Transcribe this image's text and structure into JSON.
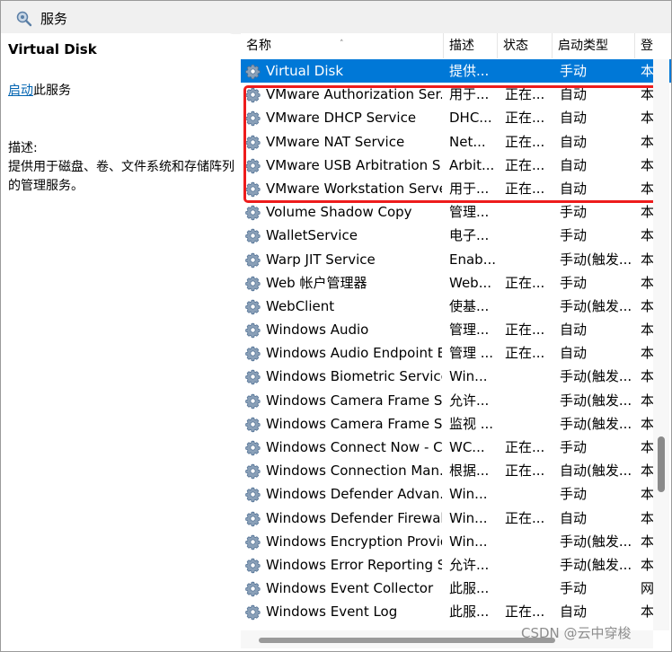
{
  "window": {
    "title": "服务"
  },
  "left_pane": {
    "service_title": "Virtual Disk",
    "start_link": "启动",
    "start_suffix": "此服务",
    "description_label": "描述:",
    "description_text": "提供用于磁盘、卷、文件系统和存储阵列的管理服务。"
  },
  "columns": {
    "name": "名称",
    "description": "描述",
    "status": "状态",
    "startup_type": "启动类型",
    "logon_as": "登"
  },
  "services": [
    {
      "name": "Virtual Disk",
      "description": "提供...",
      "status": "",
      "startup": "手动",
      "logon": "本",
      "selected": true
    },
    {
      "name": "VMware Authorization Ser...",
      "description": "用于...",
      "status": "正在...",
      "startup": "自动",
      "logon": "本"
    },
    {
      "name": "VMware DHCP Service",
      "description": "DHC...",
      "status": "正在...",
      "startup": "自动",
      "logon": "本"
    },
    {
      "name": "VMware NAT Service",
      "description": "Net...",
      "status": "正在...",
      "startup": "自动",
      "logon": "本"
    },
    {
      "name": "VMware USB Arbitration S...",
      "description": "Arbit...",
      "status": "正在...",
      "startup": "自动",
      "logon": "本"
    },
    {
      "name": "VMware Workstation Server",
      "description": "用于...",
      "status": "正在...",
      "startup": "自动",
      "logon": "本"
    },
    {
      "name": "Volume Shadow Copy",
      "description": "管理...",
      "status": "",
      "startup": "手动",
      "logon": "本"
    },
    {
      "name": "WalletService",
      "description": "电子...",
      "status": "",
      "startup": "手动",
      "logon": "本"
    },
    {
      "name": "Warp JIT Service",
      "description": "Enab...",
      "status": "",
      "startup": "手动(触发...",
      "logon": "本"
    },
    {
      "name": "Web 帐户管理器",
      "description": "Web...",
      "status": "正在...",
      "startup": "手动",
      "logon": "本"
    },
    {
      "name": "WebClient",
      "description": "使基...",
      "status": "",
      "startup": "手动(触发...",
      "logon": "本"
    },
    {
      "name": "Windows Audio",
      "description": "管理...",
      "status": "正在...",
      "startup": "自动",
      "logon": "本"
    },
    {
      "name": "Windows Audio Endpoint B...",
      "description": "管理 ...",
      "status": "正在...",
      "startup": "自动",
      "logon": "本"
    },
    {
      "name": "Windows Biometric Service",
      "description": "Win...",
      "status": "",
      "startup": "手动(触发...",
      "logon": "本"
    },
    {
      "name": "Windows Camera Frame S...",
      "description": "允许...",
      "status": "",
      "startup": "手动(触发...",
      "logon": "本"
    },
    {
      "name": "Windows Camera Frame S...",
      "description": "监视 ...",
      "status": "",
      "startup": "手动(触发...",
      "logon": "本"
    },
    {
      "name": "Windows Connect Now - C...",
      "description": "WC...",
      "status": "正在...",
      "startup": "手动",
      "logon": "本"
    },
    {
      "name": "Windows Connection Man...",
      "description": "根据...",
      "status": "正在...",
      "startup": "自动(触发...",
      "logon": "本"
    },
    {
      "name": "Windows Defender Advan...",
      "description": "Win...",
      "status": "",
      "startup": "手动",
      "logon": "本"
    },
    {
      "name": "Windows Defender Firewall",
      "description": "Win...",
      "status": "正在...",
      "startup": "自动",
      "logon": "本"
    },
    {
      "name": "Windows Encryption Provid...",
      "description": "Win...",
      "status": "",
      "startup": "手动(触发...",
      "logon": "本"
    },
    {
      "name": "Windows Error Reporting S...",
      "description": "允许...",
      "status": "",
      "startup": "手动(触发...",
      "logon": "本"
    },
    {
      "name": "Windows Event Collector",
      "description": "此服...",
      "status": "",
      "startup": "手动",
      "logon": "网"
    },
    {
      "name": "Windows Event Log",
      "description": "此服...",
      "status": "正在...",
      "startup": "自动",
      "logon": "本"
    }
  ],
  "watermark": "CSDN @云中穿梭",
  "colors": {
    "selection": "#0078d7",
    "highlight_box": "#ee1c1c",
    "link": "#0063b1"
  },
  "icons": {
    "title": "services-gear-search-icon",
    "row": "service-gear-icon"
  }
}
